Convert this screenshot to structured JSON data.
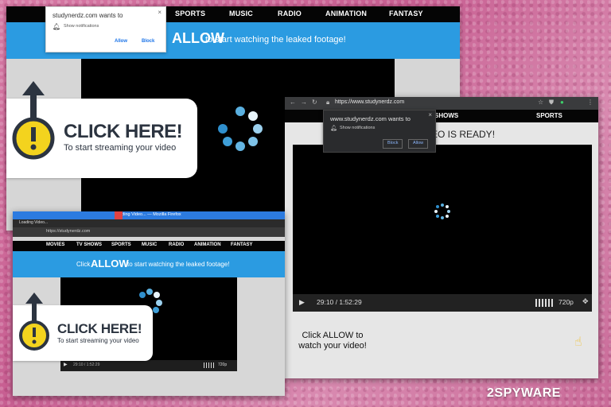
{
  "site": {
    "domain_short": "studynerdz.com",
    "url": "https://www.studynerdz.com"
  },
  "window_back": {
    "nav_items": [
      "SPORTS",
      "MUSIC",
      "RADIO",
      "ANIMATION",
      "FANTASY"
    ],
    "banner": {
      "allow": "ALLOW",
      "rest": "to start watching the leaked footage!"
    },
    "notification": {
      "title": "studynerdz.com wants to",
      "close": "×",
      "desc": "Show notifications",
      "allow": "Allow",
      "block": "Block"
    }
  },
  "click_big": {
    "heading": "CLICK HERE!",
    "sub": "To start streaming your video"
  },
  "window_front": {
    "nav_items": [
      "SHOWS",
      "SPORTS"
    ],
    "ready_text": "EO IS READY!",
    "notification": {
      "title": "www.studynerdz.com wants to",
      "close": "×",
      "desc": "Show notifications",
      "block": "Block",
      "allow": "Allow"
    },
    "player": {
      "play": "▶",
      "time": "29:10 / 1:52:29",
      "quality": "720p",
      "fullscreen": "✥"
    },
    "cta": "Click ALLOW to watch your video!"
  },
  "window_small": {
    "title": "Loading Video... — Mozilla Firefox",
    "tab": "Loading Video...",
    "url": "https://studynerdz.com",
    "nav_items": [
      "MOVIES",
      "TV SHOWS",
      "SPORTS",
      "MUSIC",
      "RADIO",
      "ANIMATION",
      "FANTASY"
    ],
    "banner": {
      "pre": "Click",
      "allow": "ALLOW",
      "rest": "to start watching the leaked footage!"
    },
    "player": {
      "play": "▶",
      "time": "29:10 / 1:52:29",
      "quality": "720p"
    }
  },
  "click_small": {
    "heading": "CLICK HERE!",
    "sub": "To start streaming your video"
  },
  "watermark": "2SPYWARE",
  "colors": {
    "banner_blue": "#2b9be1",
    "spinner_blue": "#4aa3d8",
    "pink_bg": "#c75e91",
    "alert_yellow": "#f3d31e"
  }
}
